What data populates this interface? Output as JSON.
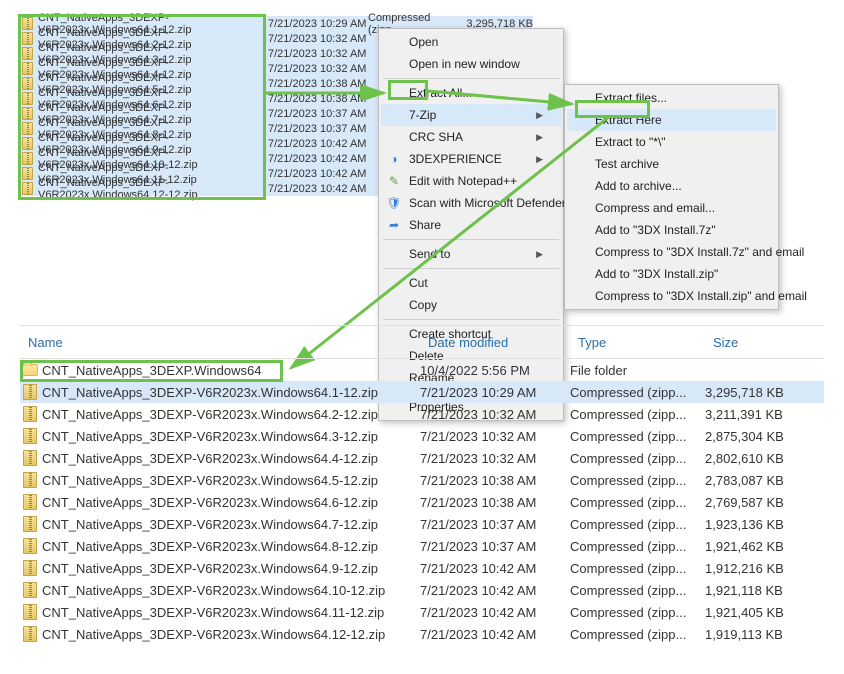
{
  "top_list": [
    {
      "name": "CNT_NativeApps_3DEXP-V6R2023x.Windows64.1-12.zip",
      "date": "7/21/2023 10:29 AM",
      "type": "Compressed (zipp...",
      "size": "3,295,718 KB"
    },
    {
      "name": "CNT_NativeApps_3DEXP-V6R2023x.Windows64.2-12.zip",
      "date": "7/21/2023 10:32 AM",
      "type": "",
      "size": ""
    },
    {
      "name": "CNT_NativeApps_3DEXP-V6R2023x.Windows64.3-12.zip",
      "date": "7/21/2023 10:32 AM",
      "type": "",
      "size": ""
    },
    {
      "name": "CNT_NativeApps_3DEXP-V6R2023x.Windows64.4-12.zip",
      "date": "7/21/2023 10:32 AM",
      "type": "",
      "size": ""
    },
    {
      "name": "CNT_NativeApps_3DEXP-V6R2023x.Windows64.5-12.zip",
      "date": "7/21/2023 10:38 AM",
      "type": "",
      "size": ""
    },
    {
      "name": "CNT_NativeApps_3DEXP-V6R2023x.Windows64.6-12.zip",
      "date": "7/21/2023 10:38 AM",
      "type": "",
      "size": ""
    },
    {
      "name": "CNT_NativeApps_3DEXP-V6R2023x.Windows64.7-12.zip",
      "date": "7/21/2023 10:37 AM",
      "type": "",
      "size": ""
    },
    {
      "name": "CNT_NativeApps_3DEXP-V6R2023x.Windows64.8-12.zip",
      "date": "7/21/2023 10:37 AM",
      "type": "",
      "size": ""
    },
    {
      "name": "CNT_NativeApps_3DEXP-V6R2023x.Windows64.9-12.zip",
      "date": "7/21/2023 10:42 AM",
      "type": "",
      "size": ""
    },
    {
      "name": "CNT_NativeApps_3DEXP-V6R2023x.Windows64.10-12.zip",
      "date": "7/21/2023 10:42 AM",
      "type": "",
      "size": ""
    },
    {
      "name": "CNT_NativeApps_3DEXP-V6R2023x.Windows64.11-12.zip",
      "date": "7/21/2023 10:42 AM",
      "type": "",
      "size": ""
    },
    {
      "name": "CNT_NativeApps_3DEXP-V6R2023x.Windows64.12-12.zip",
      "date": "7/21/2023 10:42 AM",
      "type": "",
      "size": ""
    }
  ],
  "context_menu": {
    "open": "Open",
    "open_new": "Open in new window",
    "extract_all": "Extract All...",
    "seven_zip": "7-Zip",
    "crc_sha": "CRC SHA",
    "threedx": "3DEXPERIENCE",
    "notepad": "Edit with Notepad++",
    "defender": "Scan with Microsoft Defender...",
    "share": "Share",
    "send_to": "Send to",
    "cut": "Cut",
    "copy": "Copy",
    "shortcut": "Create shortcut",
    "delete": "Delete",
    "rename": "Rename",
    "properties": "Properties"
  },
  "submenu": {
    "extract_files": "Extract files...",
    "extract_here": "Extract Here",
    "extract_to": "Extract to \"*\\\"",
    "test": "Test archive",
    "add": "Add to archive...",
    "compress_email": "Compress and email...",
    "add_7z": "Add to \"3DX Install.7z\"",
    "comp_7z_email": "Compress to \"3DX Install.7z\" and email",
    "add_zip": "Add to \"3DX Install.zip\"",
    "comp_zip_email": "Compress to \"3DX Install.zip\" and email"
  },
  "columns": {
    "name": "Name",
    "date": "Date modified",
    "type": "Type",
    "size": "Size"
  },
  "bottom_list": [
    {
      "kind": "folder",
      "name": "CNT_NativeApps_3DEXP.Windows64",
      "date": "10/4/2022 5:56 PM",
      "type": "File folder",
      "size": ""
    },
    {
      "kind": "zip",
      "name": "CNT_NativeApps_3DEXP-V6R2023x.Windows64.1-12.zip",
      "date": "7/21/2023 10:29 AM",
      "type": "Compressed (zipp...",
      "size": "3,295,718 KB"
    },
    {
      "kind": "zip",
      "name": "CNT_NativeApps_3DEXP-V6R2023x.Windows64.2-12.zip",
      "date": "7/21/2023 10:32 AM",
      "type": "Compressed (zipp...",
      "size": "3,211,391 KB"
    },
    {
      "kind": "zip",
      "name": "CNT_NativeApps_3DEXP-V6R2023x.Windows64.3-12.zip",
      "date": "7/21/2023 10:32 AM",
      "type": "Compressed (zipp...",
      "size": "2,875,304 KB"
    },
    {
      "kind": "zip",
      "name": "CNT_NativeApps_3DEXP-V6R2023x.Windows64.4-12.zip",
      "date": "7/21/2023 10:32 AM",
      "type": "Compressed (zipp...",
      "size": "2,802,610 KB"
    },
    {
      "kind": "zip",
      "name": "CNT_NativeApps_3DEXP-V6R2023x.Windows64.5-12.zip",
      "date": "7/21/2023 10:38 AM",
      "type": "Compressed (zipp...",
      "size": "2,783,087 KB"
    },
    {
      "kind": "zip",
      "name": "CNT_NativeApps_3DEXP-V6R2023x.Windows64.6-12.zip",
      "date": "7/21/2023 10:38 AM",
      "type": "Compressed (zipp...",
      "size": "2,769,587 KB"
    },
    {
      "kind": "zip",
      "name": "CNT_NativeApps_3DEXP-V6R2023x.Windows64.7-12.zip",
      "date": "7/21/2023 10:37 AM",
      "type": "Compressed (zipp...",
      "size": "1,923,136 KB"
    },
    {
      "kind": "zip",
      "name": "CNT_NativeApps_3DEXP-V6R2023x.Windows64.8-12.zip",
      "date": "7/21/2023 10:37 AM",
      "type": "Compressed (zipp...",
      "size": "1,921,462 KB"
    },
    {
      "kind": "zip",
      "name": "CNT_NativeApps_3DEXP-V6R2023x.Windows64.9-12.zip",
      "date": "7/21/2023 10:42 AM",
      "type": "Compressed (zipp...",
      "size": "1,912,216 KB"
    },
    {
      "kind": "zip",
      "name": "CNT_NativeApps_3DEXP-V6R2023x.Windows64.10-12.zip",
      "date": "7/21/2023 10:42 AM",
      "type": "Compressed (zipp...",
      "size": "1,921,118 KB"
    },
    {
      "kind": "zip",
      "name": "CNT_NativeApps_3DEXP-V6R2023x.Windows64.11-12.zip",
      "date": "7/21/2023 10:42 AM",
      "type": "Compressed (zipp...",
      "size": "1,921,405 KB"
    },
    {
      "kind": "zip",
      "name": "CNT_NativeApps_3DEXP-V6R2023x.Windows64.12-12.zip",
      "date": "7/21/2023 10:42 AM",
      "type": "Compressed (zipp...",
      "size": "1,919,113 KB"
    }
  ]
}
